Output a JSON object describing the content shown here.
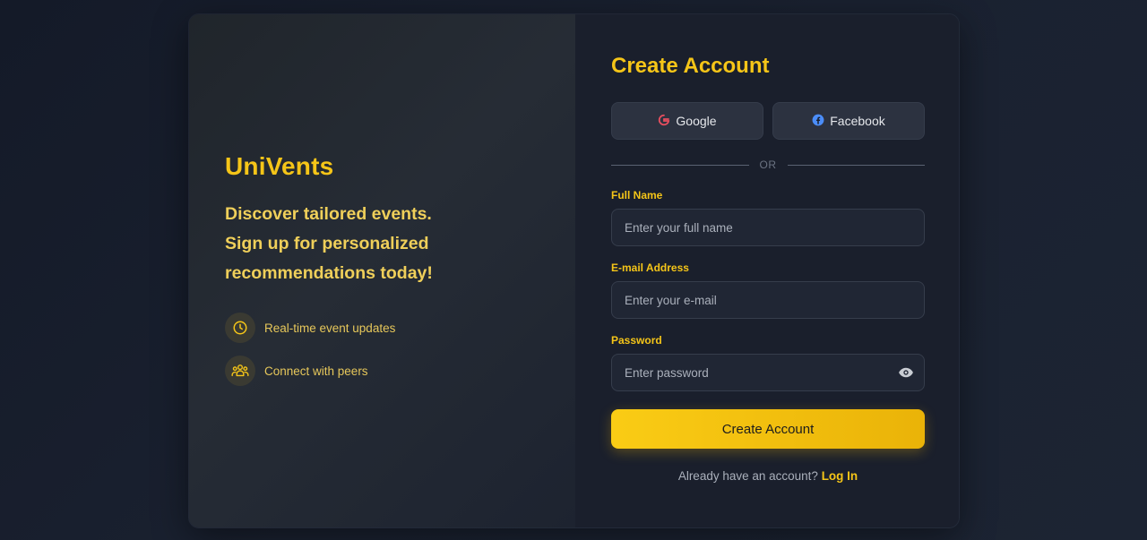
{
  "left": {
    "brand": "UniVents",
    "tagline": "Discover tailored events. Sign up for personalized recommendations today!",
    "features": [
      {
        "icon": "clock-icon",
        "label": "Real-time event updates"
      },
      {
        "icon": "users-icon",
        "label": "Connect with peers"
      }
    ]
  },
  "form": {
    "title": "Create Account",
    "social": {
      "google_label": "Google",
      "facebook_label": "Facebook"
    },
    "divider_text": "OR",
    "full_name": {
      "label": "Full Name",
      "placeholder": "Enter your full name"
    },
    "email": {
      "label": "E-mail Address",
      "placeholder": "Enter your e-mail"
    },
    "password": {
      "label": "Password",
      "placeholder": "Enter password"
    },
    "submit_label": "Create Account",
    "footer": {
      "prompt": "Already have an account?",
      "link": "Log In"
    }
  },
  "colors": {
    "accent": "#f5c518",
    "background": "#141a28",
    "panel": "#1a1f2c"
  }
}
